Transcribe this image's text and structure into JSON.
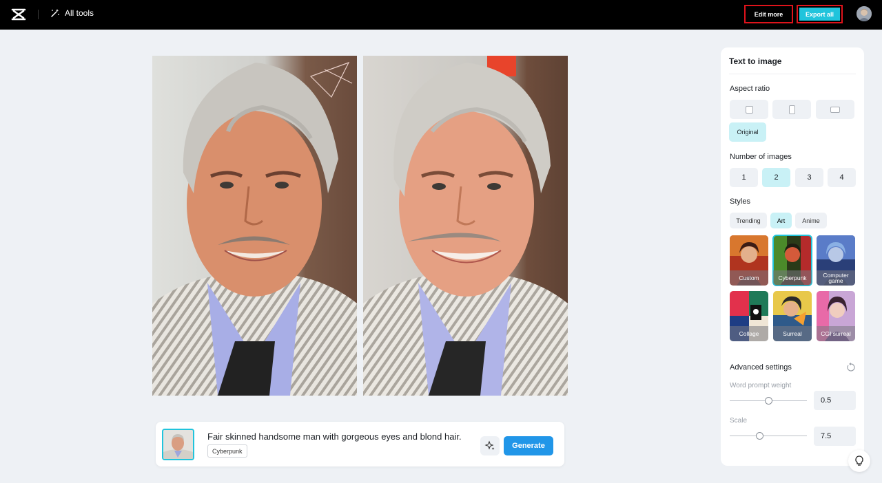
{
  "topbar": {
    "all_tools_label": "All tools",
    "edit_more_label": "Edit more",
    "export_all_label": "Export all"
  },
  "prompt": {
    "text": "Fair skinned handsome man with gorgeous eyes and blond hair.",
    "style_tag": "Cyberpunk",
    "generate_label": "Generate"
  },
  "panel": {
    "title": "Text to image",
    "aspect_ratio": {
      "label": "Aspect ratio",
      "options": [
        "square-icon",
        "portrait-icon",
        "landscape-icon"
      ],
      "original_label": "Original",
      "selected": "Original"
    },
    "number_of_images": {
      "label": "Number of images",
      "options": [
        "1",
        "2",
        "3",
        "4"
      ],
      "selected": "2"
    },
    "styles": {
      "label": "Styles",
      "tabs": [
        "Trending",
        "Art",
        "Anime"
      ],
      "selected_tab": "Art",
      "cards": [
        "Custom",
        "Cyberpunk",
        "Computer game",
        "Collage",
        "Surreal",
        "CGI surreal"
      ],
      "selected_card": "Cyberpunk"
    },
    "advanced": {
      "label": "Advanced settings",
      "word_prompt_weight_label": "Word prompt weight",
      "word_prompt_weight_value": "0.5",
      "word_prompt_weight_level": 0.5,
      "scale_label": "Scale",
      "scale_value": "7.5",
      "scale_level": 0.375
    }
  },
  "colors": {
    "accent": "#20c4dc",
    "selected_bg": "#c9f1f6",
    "generate": "#2196e8",
    "highlight_border": "#e0131b"
  }
}
